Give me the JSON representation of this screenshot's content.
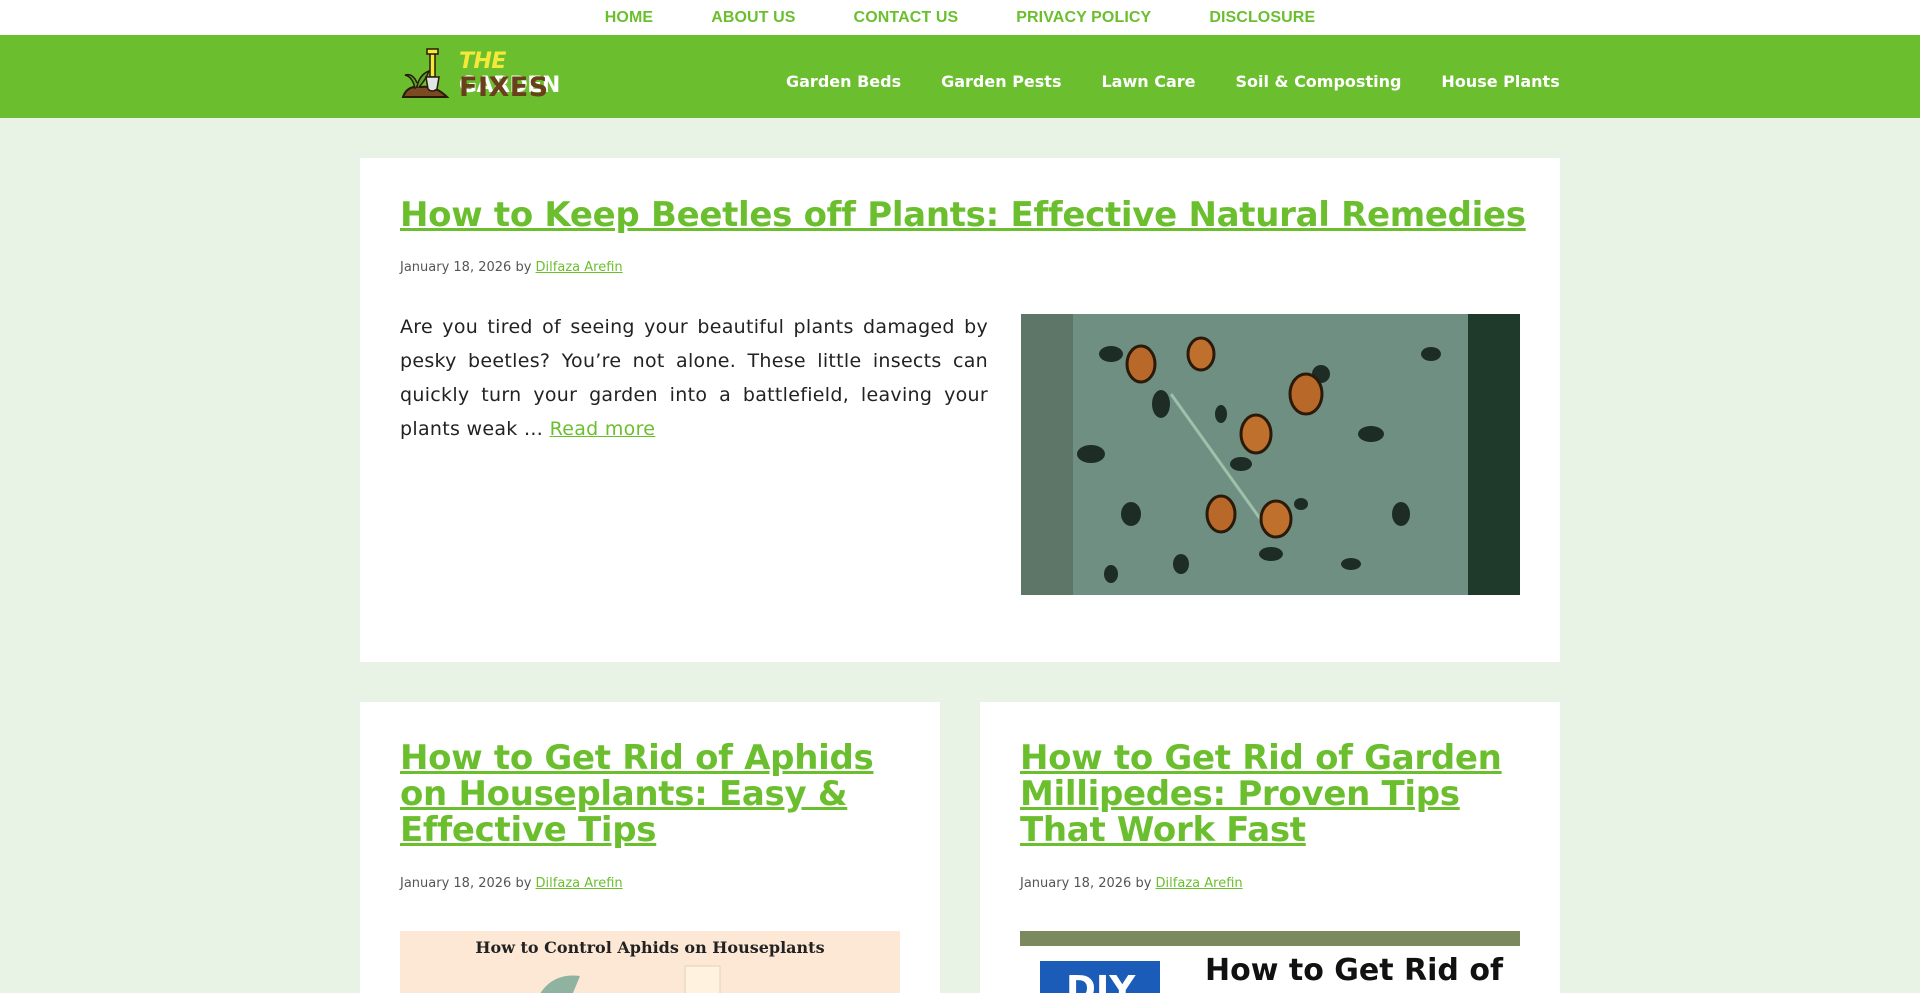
{
  "topbar": {
    "links": [
      "HOME",
      "ABOUT US",
      "CONTACT US",
      "PRIVACY POLICY",
      "DISCLOSURE"
    ]
  },
  "logo": {
    "word_the": "THE",
    "word_garden": "GARDEN",
    "word_fixes": "FIXES"
  },
  "nav": {
    "items": [
      "Garden Beds",
      "Garden Pests",
      "Lawn Care",
      "Soil & Composting",
      "House Plants"
    ]
  },
  "posts": [
    {
      "title": "How to Keep Beetles off Plants: Effective Natural Remedies",
      "date": "January 18, 2026",
      "by": "by",
      "author": "Dilfaza Arefin",
      "excerpt": "Are you tired of seeing your beautiful plants damaged by pesky beetles? You’re not alone. These little insects can quickly turn your garden into a battlefield, leaving your plants weak …",
      "read_more": "Read more"
    },
    {
      "title": "How to Get Rid of Aphids on Houseplants: Easy & Effective Tips",
      "date": "January 18, 2026",
      "by": "by",
      "author": "Dilfaza Arefin",
      "image_caption": "How to Control Aphids on Houseplants"
    },
    {
      "title": "How to Get Rid of Garden Millipedes: Proven Tips That Work Fast",
      "date": "January 18, 2026",
      "by": "by",
      "author": "Dilfaza Arefin",
      "image_badge": "DIY",
      "image_headline": "How to Get Rid of"
    }
  ],
  "colors": {
    "brand_green": "#6bbf2e",
    "page_bg": "#e8f3e6",
    "logo_brown": "#6a3f1b",
    "logo_yellow": "#f6e839"
  }
}
